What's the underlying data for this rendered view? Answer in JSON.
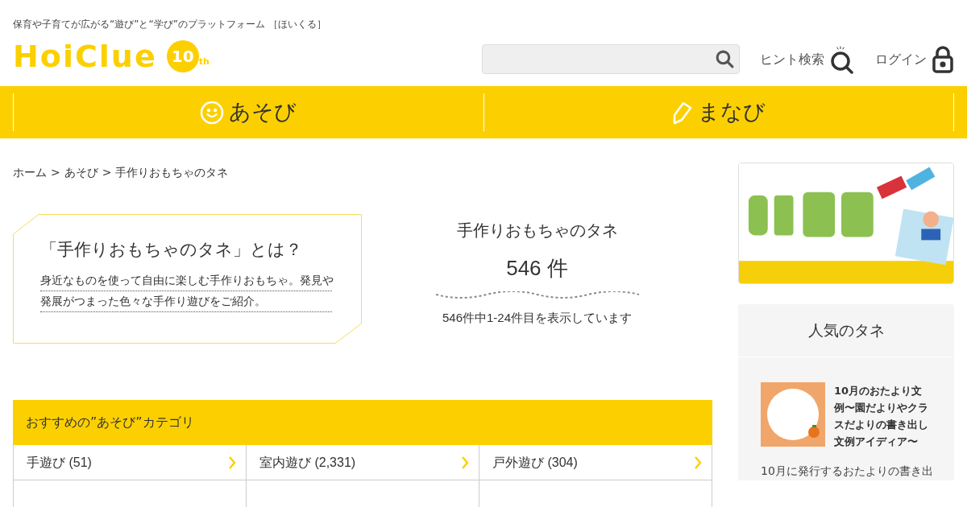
{
  "header": {
    "tagline": "保育や子育てが広がる“遊び”と“学び”のプラットフォーム ［ほいくる］",
    "logo": {
      "word": "HoiClue",
      "badge": "10",
      "badge_suffix": "th"
    },
    "links": [
      {
        "kind": "hint",
        "label": "ヒント検索"
      },
      {
        "kind": "login",
        "label": "ログイン"
      }
    ]
  },
  "nav": [
    {
      "kind": "smile",
      "label": "あそび"
    },
    {
      "kind": "pencil",
      "label": "まなび"
    }
  ],
  "breadcrumb": {
    "separator": ">",
    "items": [
      "ホーム",
      "あそび",
      "手作りおもちゃのタネ"
    ]
  },
  "intro": {
    "title": "「手作りおもちゃのタネ」とは？",
    "lines": [
      "身近なものを使って自由に楽しむ手作りおもちゃ。発見や",
      "発展がつまった色々な手作り遊びをご紹介。"
    ]
  },
  "summary": {
    "title": "手作りおもちゃのタネ",
    "count": "546 件",
    "range": "546件中1-24件目を表示しています"
  },
  "categories": {
    "title": "おすすめの”あそび”カテゴリ",
    "items": [
      "手遊び (51)",
      "室内遊び (2,331)",
      "戸外遊び (304)"
    ]
  },
  "sidebar": {
    "popular": {
      "title": "人気のタネ",
      "items": [
        {
          "title": "10月のおたより文例〜園だよりやクラスだよりの書き出し文例アイディア〜",
          "excerpt": "10月に発行するおたよりの書き出"
        }
      ]
    }
  }
}
